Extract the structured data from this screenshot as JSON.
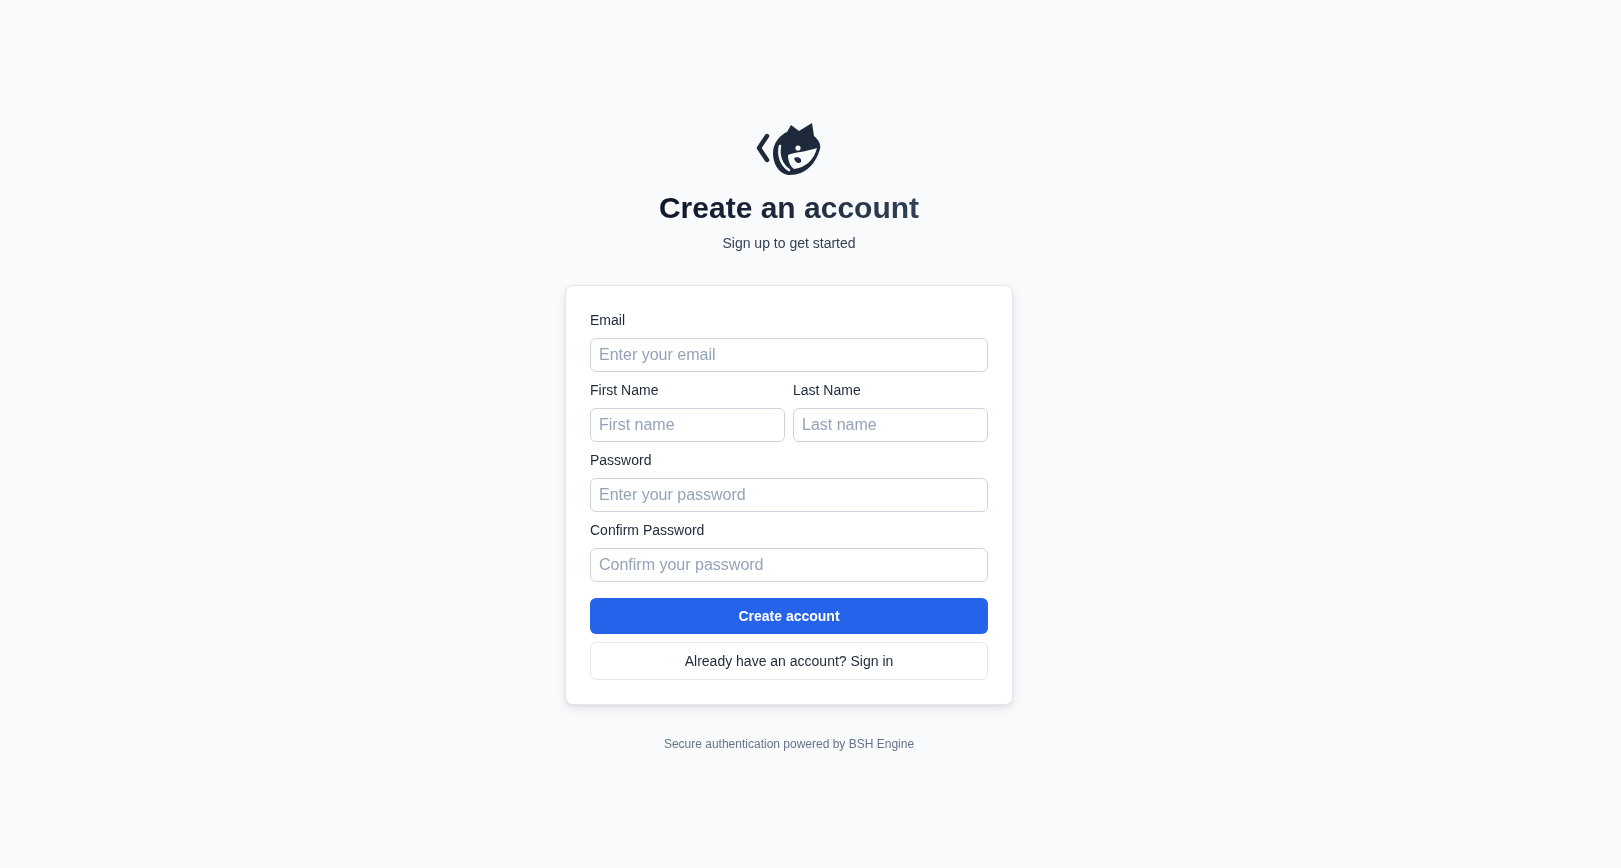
{
  "header": {
    "title": "Create an account",
    "subtitle": "Sign up to get started"
  },
  "form": {
    "rows": [
      {
        "fields": [
          {
            "label": "Email",
            "placeholder": "Enter your email"
          }
        ]
      },
      {
        "fields": [
          {
            "label": "First Name",
            "placeholder": "First name"
          },
          {
            "label": "Last Name",
            "placeholder": "Last name"
          }
        ]
      },
      {
        "fields": [
          {
            "label": "Password",
            "placeholder": "Enter your password"
          }
        ]
      },
      {
        "fields": [
          {
            "label": "Confirm Password",
            "placeholder": "Confirm your password"
          }
        ]
      }
    ],
    "submit_button": "Create account",
    "signin_button": "Already have an account? Sign in"
  },
  "footer": "Secure authentication powered by BSH Engine"
}
